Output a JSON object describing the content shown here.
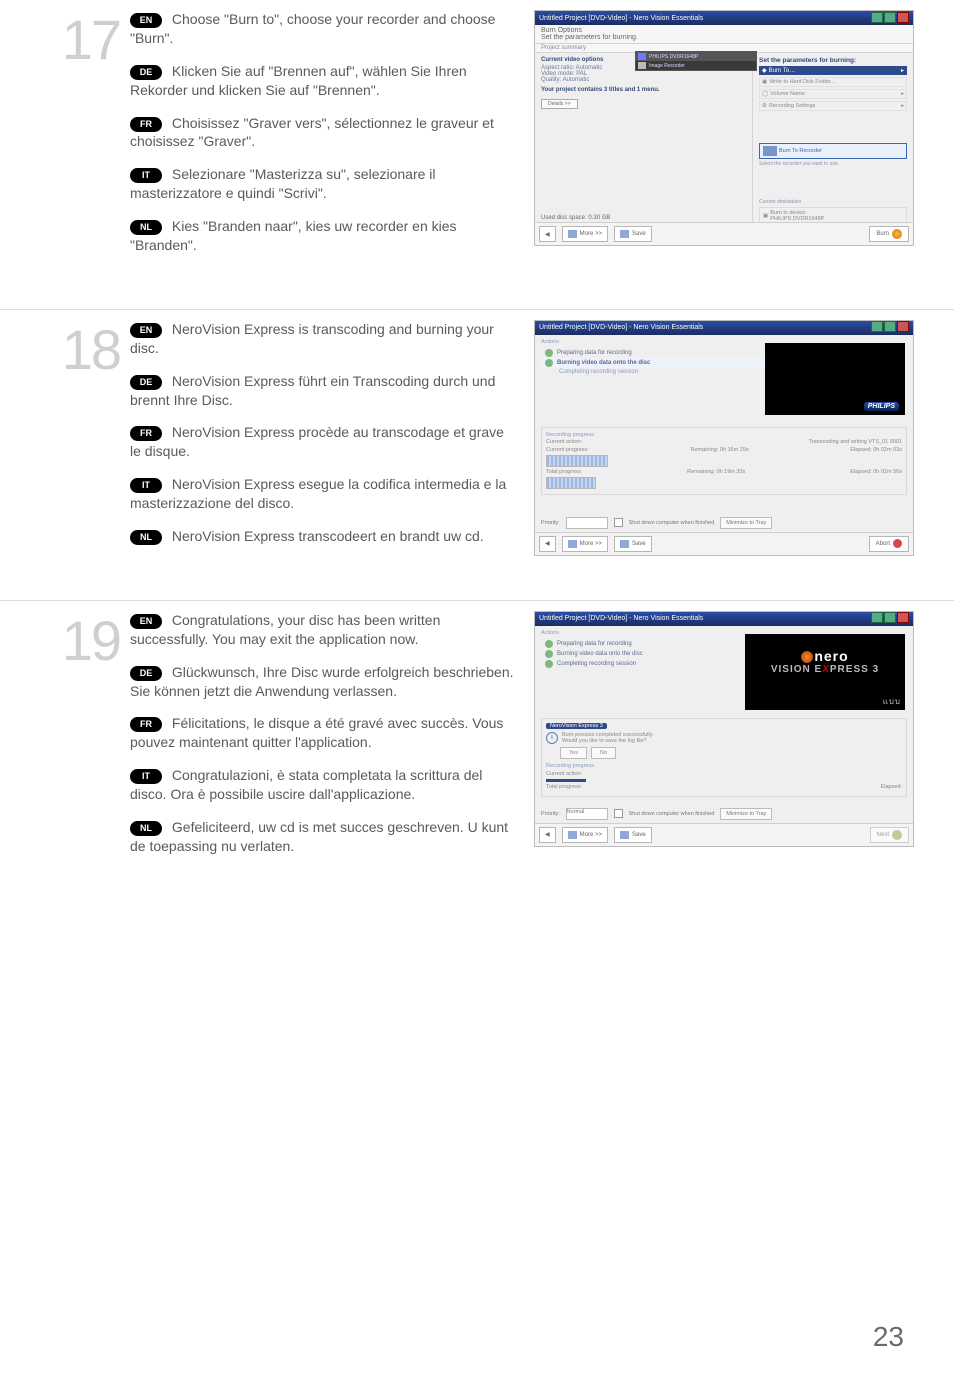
{
  "steps": {
    "17": {
      "number": "17",
      "en": "Choose \"Burn to\", choose your recorder and choose \"Burn\".",
      "de": "Klicken Sie auf \"Brennen auf\", wählen Sie Ihren Rekorder und klicken Sie auf \"Brennen\".",
      "fr": "Choisissez \"Graver vers\", sélectionnez le graveur et choisissez \"Graver\".",
      "it": "Selezionare \"Masterizza su\", selezionare il masterizzatore e quindi \"Scrivi\".",
      "nl": "Kies \"Branden naar\", kies uw recorder en kies \"Branden\"."
    },
    "18": {
      "number": "18",
      "en": "NeroVision Express is transcoding and burning your disc.",
      "de": "NeroVision Express führt ein Transcoding durch und brennt Ihre Disc.",
      "fr": "NeroVision Express procède au transcodage et grave le disque.",
      "it": "NeroVision Express esegue la codifica intermedia e la masterizzazione del disco.",
      "nl": "NeroVision Express transcodeert en brandt uw cd."
    },
    "19": {
      "number": "19",
      "en": "Congratulations, your disc has been written successfully. You may exit the application now.",
      "de": "Glückwunsch, Ihre Disc wurde erfolgreich beschrieben. Sie können jetzt die Anwendung verlassen.",
      "fr": "Félicitations, le disque a été gravé avec succès. Vous pouvez maintenant quitter l'application.",
      "it": "Congratulazioni, è stata completata la scrittura del disco. Ora è possibile uscire dall'applicazione.",
      "nl": "Gefeliciteerd, uw cd is met succes geschreven. U kunt de toepassing nu verlaten."
    }
  },
  "labels": {
    "en": "EN",
    "de": "DE",
    "fr": "FR",
    "it": "IT",
    "nl": "NL"
  },
  "page_number": "23",
  "shot17": {
    "title": "Untitled Project [DVD-Video] - Nero Vision Essentials",
    "burn_options": "Burn Options",
    "set_params": "Set the parameters for burning.",
    "project_summary": "Project summary",
    "current_video_options": "Current video options",
    "aspect": "Aspect ratio: Automatic",
    "video_mode": "Video mode: PAL",
    "quality": "Quality: Automatic",
    "project_contains": "Your project contains 3 titles and 1 menu.",
    "details": "Details >>",
    "philips_rec": "PHILIPS DVDR1648P",
    "image_rec": "Image Recorder",
    "rh": "Set the parameters for burning:",
    "burn_to": "Burn To…",
    "write_hd": "Write to Hard Disk Folder…",
    "volume_name": "Volume Name",
    "rec_settings": "Recording Settings",
    "burn_to_rec": "Burn To Recorder",
    "select_rec": "Select the recorder you want to use.",
    "current_destination": "Current destination",
    "burn_to_device": "Burn to device:",
    "device": "PHILIPS DVDR1648P",
    "used": "Used disc space: 0.30 GB",
    "more": "More >>",
    "save": "Save",
    "burn": "Burn"
  },
  "shot18": {
    "title": "Untitled Project [DVD-Video] - Nero Vision Essentials",
    "actions": "Actions",
    "a1": "Preparing data for recording",
    "a2": "Burning video data onto the disc",
    "a2_sub": "Completing recording session",
    "dvdlabel": "PHILIPS",
    "recording_progress": "Recording progress",
    "current_action": "Current action:",
    "current_action_v": "Transcoding and writing VTS_01 0001",
    "current_progress": "Current progress:",
    "remaining1": "Remaining:   0h 16m 29s",
    "elapsed1": "Elapsed:   0h 02m 03s",
    "total_progress": "Total progress:",
    "remaining2": "Remaining:   0h 19m 33s",
    "elapsed2": "Elapsed:   0h 02m 56s",
    "priority": "Priority:",
    "shutdown": "Shut down computer when finished",
    "minimize": "Minimize to Tray",
    "more": "More >>",
    "save": "Save",
    "abort": "Abort"
  },
  "shot19": {
    "title": "Untitled Project [DVD-Video] - Nero Vision Essentials",
    "actions": "Actions",
    "a1": "Preparing data for recording",
    "a2": "Burning video data onto the disc",
    "a3": "Completing recording session",
    "logo_line1": "nero",
    "logo_line2_a": "VISION E",
    "logo_line2_b": "PRESS 3",
    "nvexp": "NeroVision Express 3",
    "dlg_l1": "Burn process completed successfully.",
    "dlg_l2": "Would you like to save the log file?",
    "yes": "Yes",
    "no": "No",
    "recording_progress": "Recording progress",
    "current_action": "Current action:",
    "current_progress": "Current progress:",
    "total_progress": "Total progress:",
    "elapsed": "Elapsed:",
    "priority": "Priority:",
    "normal": "Normal",
    "shutdown": "Shut down computer when finished",
    "minimize": "Minimize to Tray",
    "more": "More >>",
    "save": "Save",
    "next": "Next"
  }
}
